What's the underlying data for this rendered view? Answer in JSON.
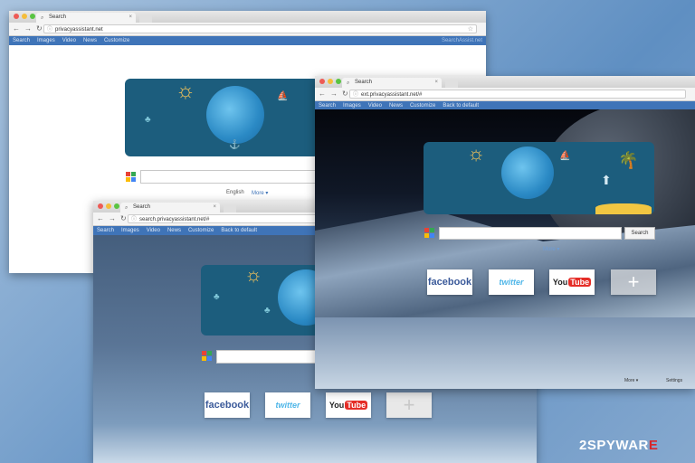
{
  "window1": {
    "tab_title": "Search",
    "url": "privacyassistant.net",
    "menu": [
      "Search",
      "Images",
      "Video",
      "News",
      "Customize"
    ],
    "menu_right": "SearchAssist.net",
    "lang": "English",
    "more": "More ▾"
  },
  "window2": {
    "tab_title": "Search",
    "url": "search.privacyassistant.net/#",
    "menu": [
      "Search",
      "Images",
      "Video",
      "News",
      "Customize",
      "Back to default"
    ],
    "tiles": [
      "facebook",
      "twitter",
      "YouTube"
    ]
  },
  "window3": {
    "tab_title": "Search",
    "url": "ext.privacyassistant.net/#",
    "menu": [
      "Search",
      "Images",
      "Video",
      "News",
      "Customize",
      "Back to default"
    ],
    "search_button": "Search",
    "more": "More ▾",
    "footer_more": "More ▾",
    "footer_settings": "Settings",
    "tiles": [
      "facebook",
      "twitter",
      "YouTube"
    ]
  },
  "watermark": {
    "number": "2",
    "text": "SPYWAR",
    "e": "E"
  },
  "colors": {
    "menubar": "#3f74b8",
    "banner": "#1c5d7d",
    "watermark_red": "#d7262b"
  }
}
